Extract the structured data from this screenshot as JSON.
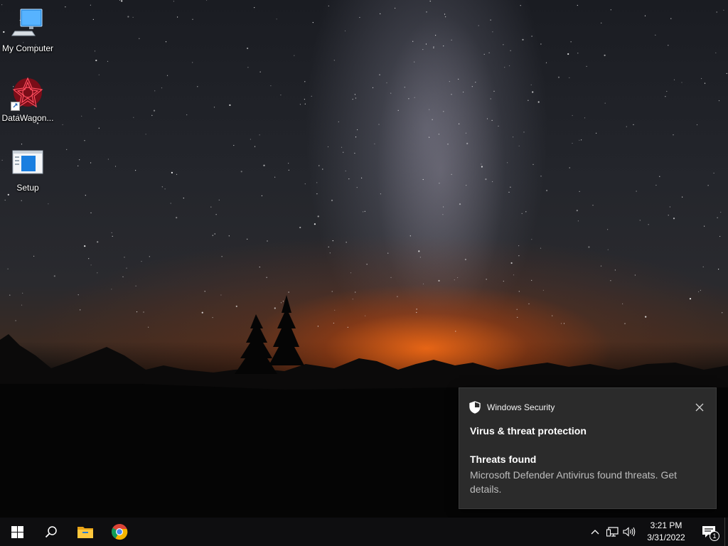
{
  "desktop": {
    "icons": [
      {
        "label": "My Computer",
        "icon": "computer-icon"
      },
      {
        "label": "DataWagon...",
        "icon": "datawagon-shortcut-icon"
      },
      {
        "label": "Setup",
        "icon": "setup-window-icon"
      }
    ]
  },
  "toast": {
    "app_name": "Windows Security",
    "app_icon": "shield-icon",
    "title": "Virus & threat protection",
    "subtitle": "Threats found",
    "body": "Microsoft Defender Antivirus found threats. Get details.",
    "close_icon": "close-icon",
    "background_color": "#2b2b2b"
  },
  "taskbar": {
    "items": [
      {
        "name": "start",
        "icon": "windows-logo-icon"
      },
      {
        "name": "search",
        "icon": "search-icon"
      },
      {
        "name": "file-explorer",
        "icon": "folder-icon"
      },
      {
        "name": "chrome",
        "icon": "chrome-icon"
      }
    ],
    "tray": {
      "icons": [
        "chevron-up-icon",
        "network-icon",
        "volume-icon"
      ],
      "time": "3:21 PM",
      "date": "3/31/2022",
      "notification_count": "1"
    },
    "background_color": "#0e0e10"
  }
}
